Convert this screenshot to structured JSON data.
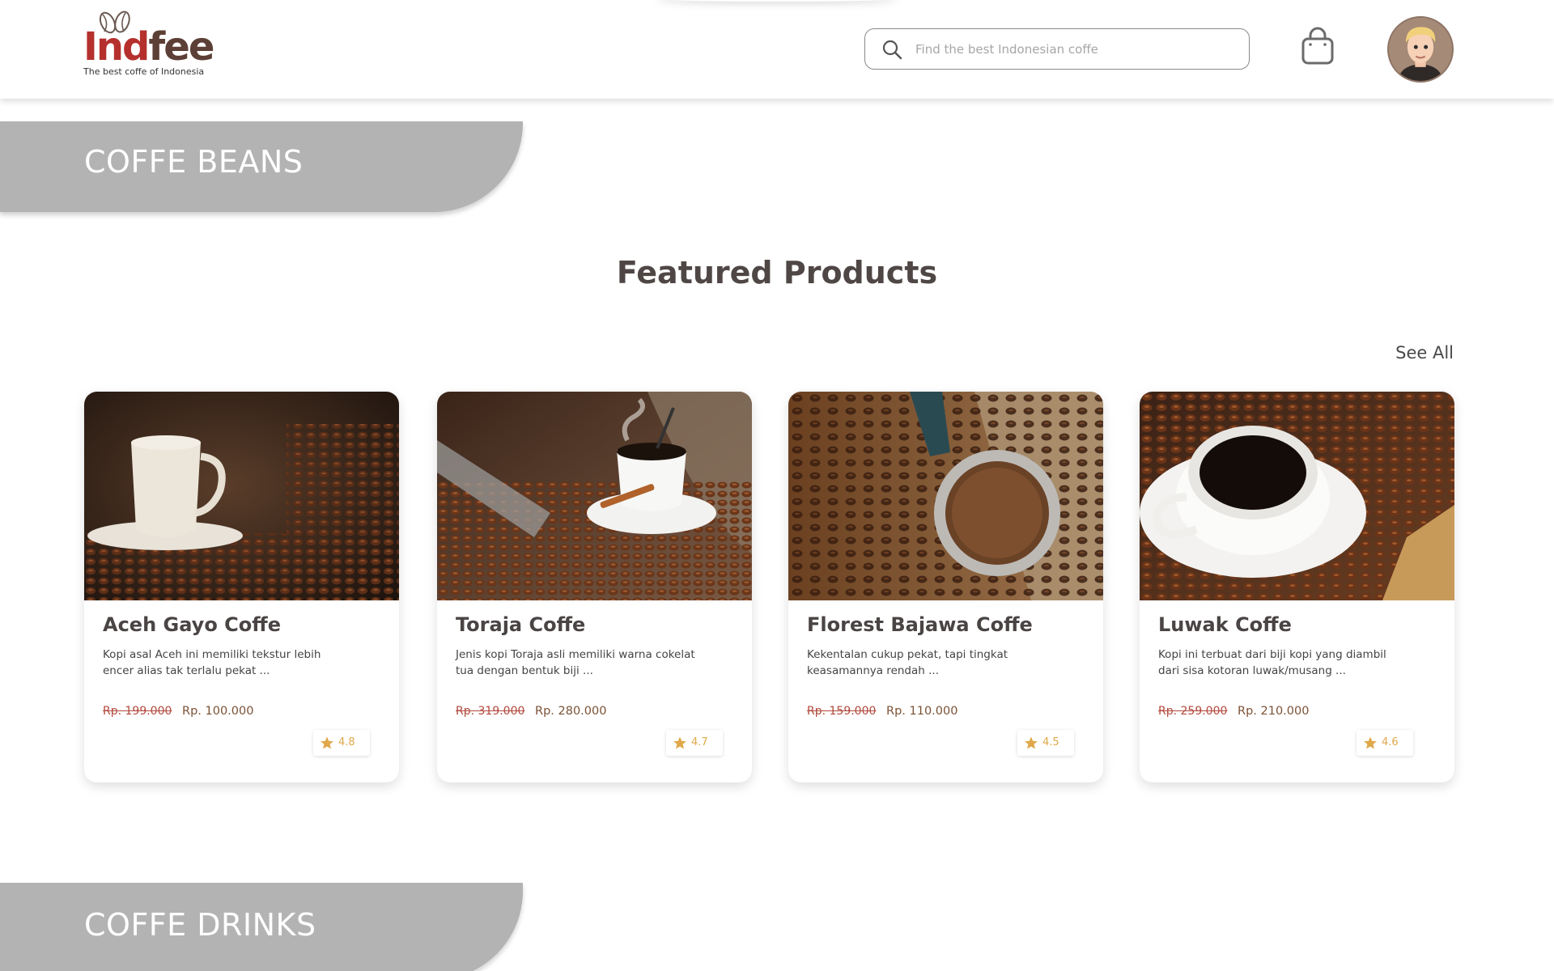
{
  "brand": {
    "name_part1": "Ind",
    "name_part2": "fee",
    "tagline": "The best coffe of Indonesia",
    "colors": {
      "red": "#b5302d",
      "brown": "#5c3f36"
    }
  },
  "search": {
    "placeholder": "Find the best Indonesian coffe",
    "value": ""
  },
  "header_icons": {
    "cart": "shopping-bag-icon",
    "profile": "avatar"
  },
  "categories": {
    "beans": "COFFE BEANS",
    "drinks": "COFFE DRINKS"
  },
  "featured": {
    "title": "Featured Products",
    "see_all": "See All"
  },
  "products": [
    {
      "name": "Aceh Gayo Coffe",
      "desc": "Kopi asal Aceh ini memiliki tekstur lebih encer alias tak terlalu pekat ...",
      "price_old": "Rp. 199.000",
      "price_new": "Rp. 100.000",
      "rating": "4.8"
    },
    {
      "name": "Toraja Coffe",
      "desc": "Jenis kopi Toraja asli memiliki warna cokelat tua dengan bentuk biji ...",
      "price_old": "Rp. 319.000",
      "price_new": "Rp. 280.000",
      "rating": "4.7"
    },
    {
      "name": "Florest Bajawa Coffe",
      "desc": "Kekentalan cukup pekat, tapi tingkat keasamannya rendah ...",
      "price_old": "Rp. 159.000",
      "price_new": "Rp. 110.000",
      "rating": "4.5"
    },
    {
      "name": "Luwak Coffe",
      "desc": "Kopi ini terbuat dari biji kopi yang diambil dari sisa kotoran luwak/musang ...",
      "price_old": "Rp. 259.000",
      "price_new": "Rp. 210.000",
      "rating": "4.6"
    }
  ],
  "colors": {
    "banner": "#b3b3b3",
    "star": "#e0a84a",
    "price_old": "#b34a3e",
    "price_new": "#7b5236"
  }
}
